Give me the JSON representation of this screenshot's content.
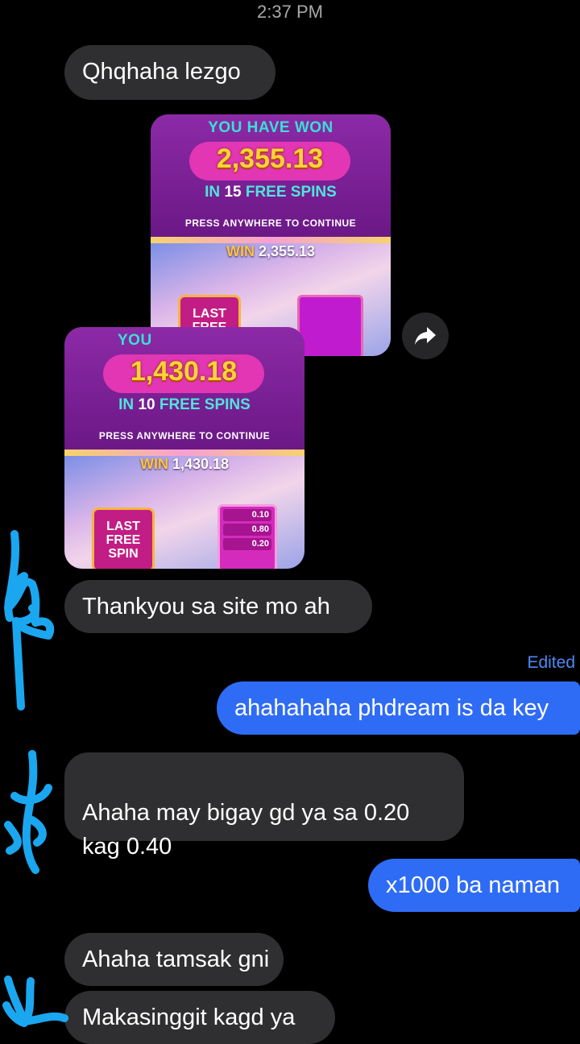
{
  "header": {
    "time": "2:37 PM"
  },
  "messages": [
    {
      "text": "Qhqhaha lezgo"
    },
    {
      "text": "Thankyou sa site mo ah"
    },
    {
      "text": "ahahahaha phdream is da key",
      "edited_label": "Edited"
    },
    {
      "text": "Ahaha may bigay gd ya sa 0.20\nkag 0.40"
    },
    {
      "text": "x1000 ba naman"
    },
    {
      "text": "Ahaha tamsak gni"
    },
    {
      "text": "Makasinggit kagd ya"
    }
  ],
  "images": [
    {
      "header": "YOU HAVE WON",
      "amount": "2,355.13",
      "spins_prefix": "IN",
      "spins_count": "15",
      "spins_suffix": "FREE SPINS",
      "press": "PRESS ANYWHERE TO CONTINUE",
      "win_label": "WIN",
      "win_value": "2,355.13",
      "box_label": "LAST FREE SPIN"
    },
    {
      "header": "YOU",
      "amount": "1,430.18",
      "spins_prefix": "IN",
      "spins_count": "10",
      "spins_suffix": "FREE SPINS",
      "press": "PRESS ANYWHERE TO CONTINUE",
      "win_label": "WIN",
      "win_value": "1,430.18",
      "box_label": "LAST FREE SPIN",
      "paytable": [
        "0.10",
        "0.80",
        "0.20"
      ]
    }
  ],
  "colors": {
    "incoming_bubble": "#2f2f31",
    "outgoing_bubble": "#2f6cf6",
    "edited": "#4b8af7",
    "scribble": "#1aa7f0"
  }
}
